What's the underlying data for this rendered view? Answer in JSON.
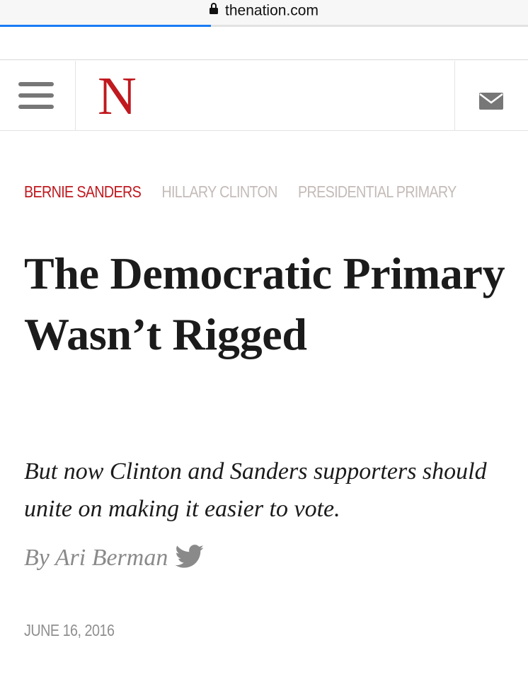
{
  "browser": {
    "url": "thenation.com",
    "lock_icon": "lock-icon",
    "load_progress": 0.4
  },
  "header": {
    "menu_icon": "hamburger-menu-icon",
    "logo_text": "N",
    "logo_color": "#c0191f",
    "mail_icon": "envelope-icon"
  },
  "article": {
    "tags": [
      {
        "label": "BERNIE SANDERS",
        "active": true
      },
      {
        "label": "HILLARY CLINTON",
        "active": false
      },
      {
        "label": "PRESIDENTIAL PRIMARY",
        "active": false
      }
    ],
    "headline": "The Democratic Primary Wasn’t Rigged",
    "dek": "But now Clinton and Sanders supporters should unite on making it easier to vote.",
    "byline": "By Ari Berman",
    "author_social_icon": "twitter-icon",
    "date": "JUNE 16, 2016"
  },
  "colors": {
    "accent_red": "#c0191f",
    "tag_muted": "#c4bbb8",
    "progress_blue": "#1a7cf5"
  }
}
